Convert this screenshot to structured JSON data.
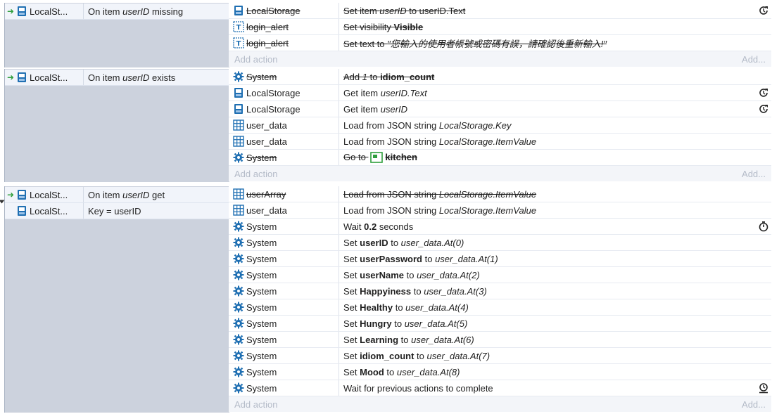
{
  "colors": {
    "accent": "#1f6fb2",
    "arrow": "#2e9e3c",
    "panel": "#ccd2dd"
  },
  "blocks": [
    {
      "conditions": [
        {
          "arrow": "➜",
          "object": "LocalSt...",
          "text": "On item ",
          "italic": "userID",
          "tail": " missing"
        }
      ],
      "actions": [
        {
          "icon": "storage-icon",
          "object": "LocalStorage",
          "strike": true,
          "p1": "Set item ",
          "p2i": "userID",
          "p3": " to userID.Text",
          "trail": "refresh-icon"
        },
        {
          "icon": "text-icon",
          "object": "login_alert",
          "strike": true,
          "p1": "Set visibility ",
          "p2b": "Visible"
        },
        {
          "icon": "text-icon",
          "object": "login_alert",
          "strike": true,
          "p1": "Set text to ",
          "p2i": "\"您輸入的使用者帳號或密碼有誤，請確認後重新輸入!\""
        }
      ],
      "add_action": "Add action",
      "add_more": "Add..."
    },
    {
      "conditions": [
        {
          "arrow": "➜",
          "object": "LocalSt...",
          "text": "On item ",
          "italic": "userID",
          "tail": " exists"
        }
      ],
      "actions": [
        {
          "icon": "gear-icon",
          "object": "System",
          "strike": true,
          "p1": "Add ",
          "p2i": "1",
          "p3": " to ",
          "p4b": "idiom_count"
        },
        {
          "icon": "storage-icon",
          "object": "LocalStorage",
          "p1": "Get item ",
          "p2i": "userID.Text",
          "trail": "refresh-icon"
        },
        {
          "icon": "storage-icon",
          "object": "LocalStorage",
          "p1": "Get item ",
          "p2i": "userID",
          "trail": "refresh-icon"
        },
        {
          "icon": "grid-icon",
          "object": "user_data",
          "p1": "Load from JSON string ",
          "p2i": "LocalStorage.Key"
        },
        {
          "icon": "grid-icon",
          "object": "user_data",
          "p1": "Load from JSON string ",
          "p2i": "LocalStorage.ItemValue"
        },
        {
          "icon": "gear-icon",
          "object": "System",
          "strike": true,
          "p1": "Go to ",
          "layout": true,
          "p4b": "kitchen"
        }
      ],
      "add_action": "Add action",
      "add_more": "Add..."
    },
    {
      "conditions": [
        {
          "arrow": "➜",
          "object": "LocalSt...",
          "text": "On item ",
          "italic": "userID",
          "tail": " get"
        },
        {
          "arrow": "",
          "object": "LocalSt...",
          "text": "Key = userID"
        }
      ],
      "actions": [
        {
          "icon": "grid-icon",
          "object": "userArray",
          "strike": true,
          "p1": "Load from JSON string ",
          "p2i": "LocalStorage.ItemValue"
        },
        {
          "icon": "grid-icon",
          "object": "user_data",
          "p1": "Load from JSON string ",
          "p2i": "LocalStorage.ItemValue"
        },
        {
          "icon": "gear-icon",
          "object": "System",
          "p1": "Wait ",
          "p2b": "0.2",
          "p3": " seconds",
          "trail": "timer-icon"
        },
        {
          "icon": "gear-icon",
          "object": "System",
          "p1": "Set ",
          "p2b": "userID",
          "p3": " to ",
          "p4i": "user_data.At(0)"
        },
        {
          "icon": "gear-icon",
          "object": "System",
          "p1": "Set ",
          "p2b": "userPassword",
          "p3": " to ",
          "p4i": "user_data.At(1)"
        },
        {
          "icon": "gear-icon",
          "object": "System",
          "p1": "Set ",
          "p2b": "userName",
          "p3": " to ",
          "p4i": "user_data.At(2)"
        },
        {
          "icon": "gear-icon",
          "object": "System",
          "p1": "Set ",
          "p2b": "Happyiness",
          "p3": " to ",
          "p4i": "user_data.At(3)"
        },
        {
          "icon": "gear-icon",
          "object": "System",
          "p1": "Set ",
          "p2b": "Healthy",
          "p3": " to ",
          "p4i": "user_data.At(4)"
        },
        {
          "icon": "gear-icon",
          "object": "System",
          "p1": "Set ",
          "p2b": "Hungry",
          "p3": " to ",
          "p4i": "user_data.At(5)"
        },
        {
          "icon": "gear-icon",
          "object": "System",
          "p1": "Set ",
          "p2b": "Learning",
          "p3": " to ",
          "p4i": "user_data.At(6)"
        },
        {
          "icon": "gear-icon",
          "object": "System",
          "p1": "Set ",
          "p2b": "idiom_count",
          "p3": " to ",
          "p4i": "user_data.At(7)"
        },
        {
          "icon": "gear-icon",
          "object": "System",
          "p1": "Set ",
          "p2b": "Mood",
          "p3": " to ",
          "p4i": "user_data.At(8)"
        },
        {
          "icon": "gear-icon",
          "object": "System",
          "p1": "Wait for previous actions to complete",
          "trail": "wait-icon"
        }
      ],
      "add_action": "Add action",
      "add_more": "Add..."
    }
  ]
}
